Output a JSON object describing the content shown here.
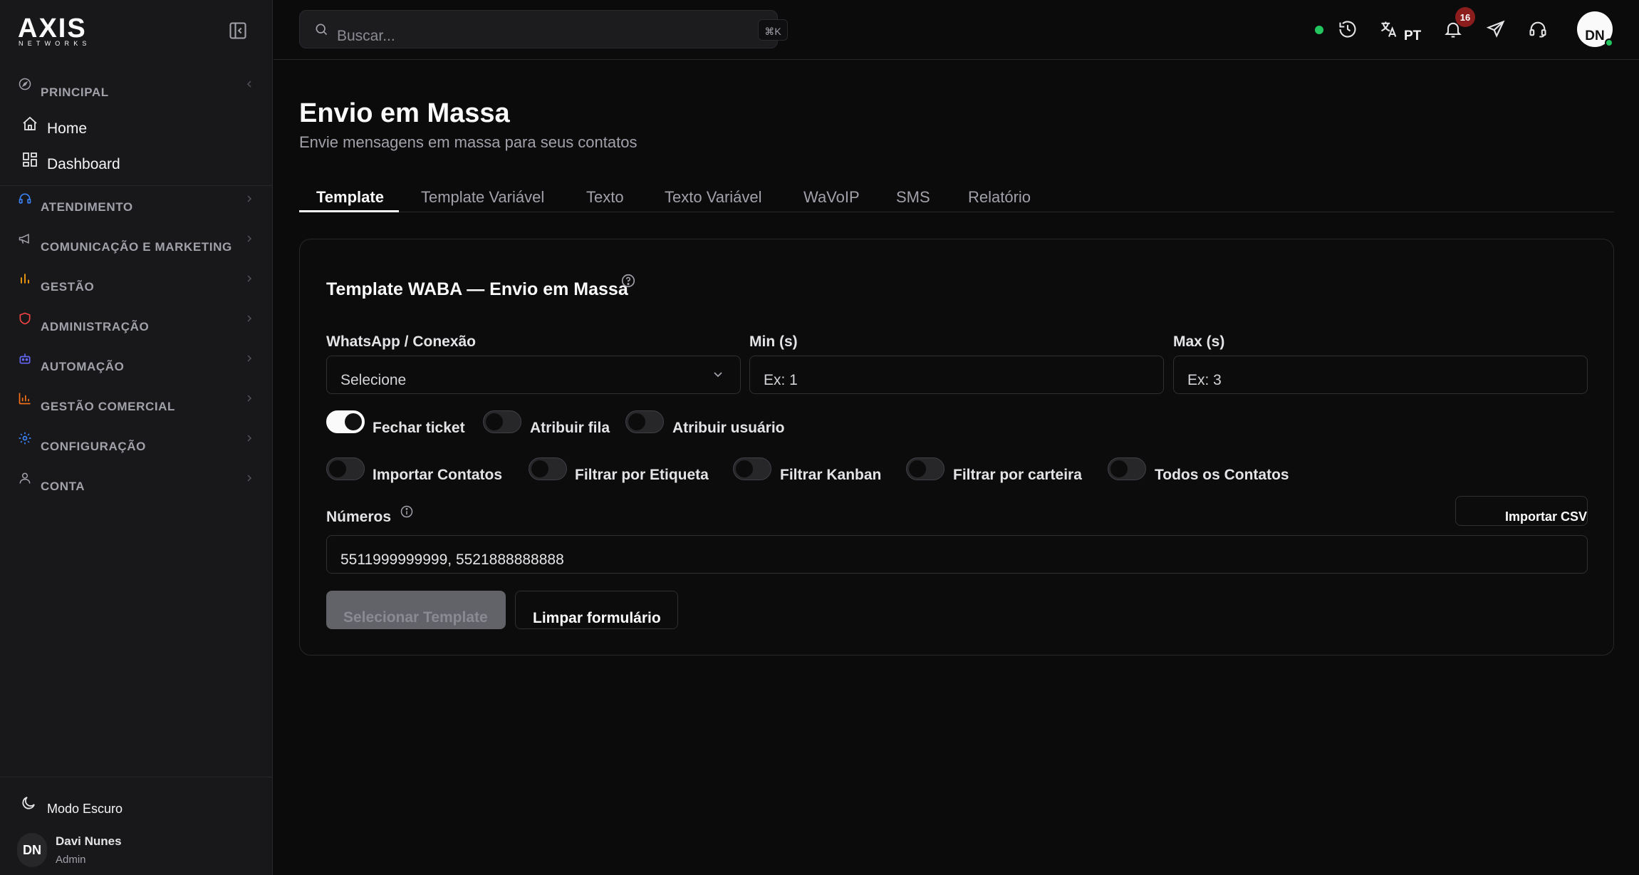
{
  "brand": {
    "logo_main": "AXIS",
    "logo_sub": "NETWORKS"
  },
  "sidebar": {
    "groups": [
      {
        "label": "PRINCIPAL",
        "icon": "compass-icon",
        "color": "#a1a1aa"
      },
      {
        "label": "ATENDIMENTO",
        "icon": "headset-icon",
        "color": "#3b82f6"
      },
      {
        "label": "COMUNICAÇÃO E MARKETING",
        "icon": "megaphone-icon",
        "color": "#a1a1aa"
      },
      {
        "label": "GESTÃO",
        "icon": "bar-chart-icon",
        "color": "#f59e0b"
      },
      {
        "label": "ADMINISTRAÇÃO",
        "icon": "shield-icon",
        "color": "#ef4444"
      },
      {
        "label": "AUTOMAÇÃO",
        "icon": "robot-icon",
        "color": "#6366f1"
      },
      {
        "label": "GESTÃO COMERCIAL",
        "icon": "chart-icon",
        "color": "#f97316"
      },
      {
        "label": "CONFIGURAÇÃO",
        "icon": "gear-icon",
        "color": "#3b82f6"
      },
      {
        "label": "CONTA",
        "icon": "user-icon",
        "color": "#a1a1aa"
      }
    ],
    "sub_items": [
      {
        "label": "Home",
        "icon": "home-icon"
      },
      {
        "label": "Dashboard",
        "icon": "grid-icon"
      }
    ],
    "dark_mode_label": "Modo Escuro",
    "user": {
      "initials": "DN",
      "name": "Davi Nunes",
      "role": "Admin"
    }
  },
  "topbar": {
    "search_placeholder": "Buscar...",
    "search_shortcut": "⌘K",
    "language": "PT",
    "notifications_count": "16",
    "avatar_initials": "DN"
  },
  "page": {
    "title": "Envio em Massa",
    "subtitle": "Envie mensagens em massa para seus contatos",
    "tabs": [
      "Template",
      "Template Variável",
      "Texto",
      "Texto Variável",
      "WaVoIP",
      "SMS",
      "Relatório"
    ],
    "active_tab": "Template"
  },
  "form": {
    "title": "Template WABA — Envio em Massa",
    "connection_label": "WhatsApp / Conexão",
    "connection_value": "Selecione",
    "min_label": "Min (s)",
    "min_placeholder": "Ex: 1",
    "max_label": "Max (s)",
    "max_placeholder": "Ex: 3",
    "toggles_row1": [
      {
        "label": "Fechar ticket",
        "on": true
      },
      {
        "label": "Atribuir fila",
        "on": false
      },
      {
        "label": "Atribuir usuário",
        "on": false
      }
    ],
    "toggles_row2": [
      {
        "label": "Importar Contatos",
        "on": false
      },
      {
        "label": "Filtrar por Etiqueta",
        "on": false
      },
      {
        "label": "Filtrar Kanban",
        "on": false
      },
      {
        "label": "Filtrar por carteira",
        "on": false
      },
      {
        "label": "Todos os Contatos",
        "on": false
      }
    ],
    "numbers_label": "Números",
    "import_csv_label": "Importar CSV",
    "numbers_placeholder": "5511999999999, 5521888888888",
    "select_template_label": "Selecionar Template",
    "clear_form_label": "Limpar formulário"
  }
}
